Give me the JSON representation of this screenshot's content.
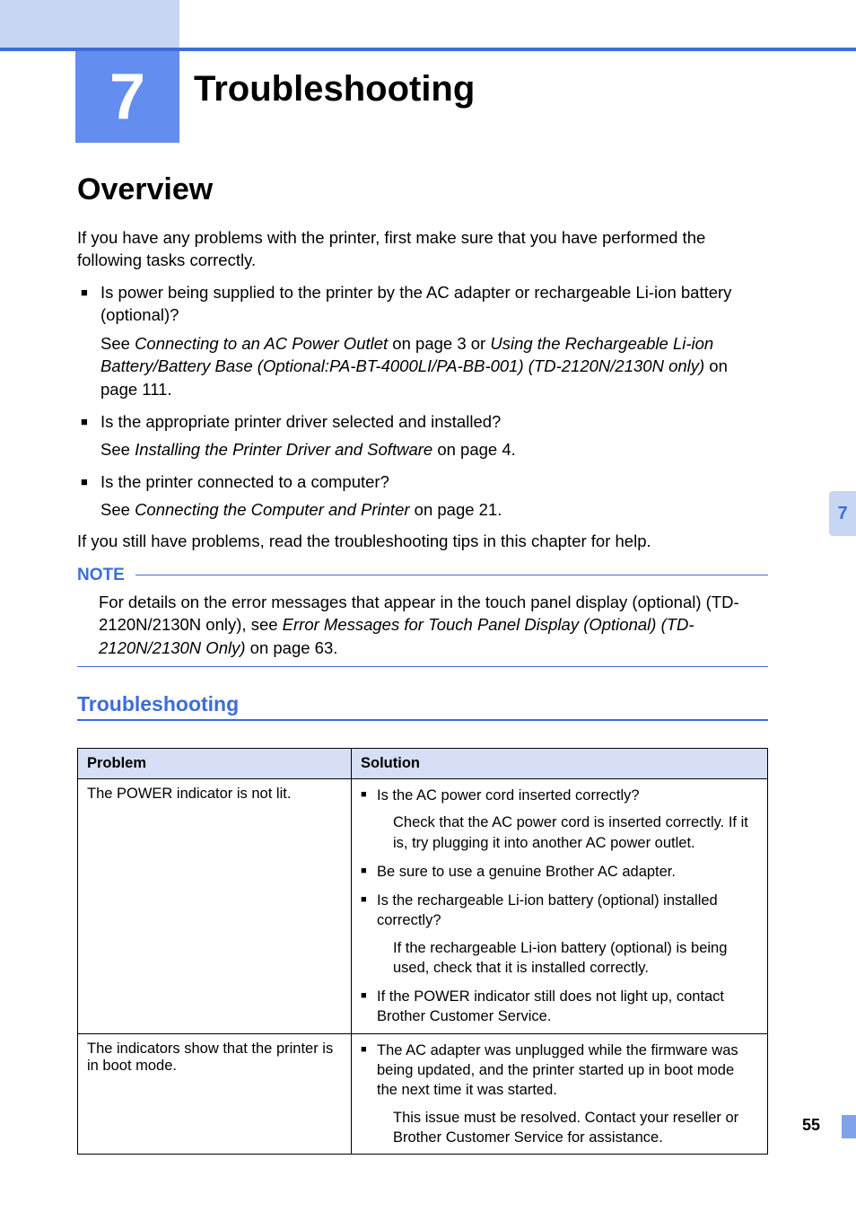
{
  "chapter": {
    "number": "7",
    "title": "Troubleshooting"
  },
  "tab": {
    "label": "7"
  },
  "overview": {
    "heading": "Overview",
    "intro": "If you have any problems with the printer, first make sure that you have performed the following tasks correctly.",
    "items": [
      {
        "q": "Is power being supplied to the printer by the AC adapter or rechargeable Li-ion battery (optional)?",
        "ref_pre": "See ",
        "ref_em1": "Connecting to an AC Power Outlet",
        "ref_mid": " on page 3 or ",
        "ref_em2": "Using the Rechargeable Li-ion Battery/Battery Base (Optional:PA-BT-4000LI/PA-BB-001) (TD-2120N/2130N only)",
        "ref_post": " on page 111."
      },
      {
        "q": "Is the appropriate printer driver selected and installed?",
        "ref_pre": "See ",
        "ref_em1": "Installing the Printer Driver and Software",
        "ref_post": " on page 4."
      },
      {
        "q": "Is the printer connected to a computer?",
        "ref_pre": "See ",
        "ref_em1": "Connecting the Computer and Printer",
        "ref_post": " on page 21."
      }
    ],
    "closing": "If you still have problems, read the troubleshooting tips in this chapter for help."
  },
  "note": {
    "label": "NOTE",
    "text_pre": "For details on the error messages that appear in the touch panel display (optional) (TD-2120N/2130N only), see ",
    "text_em": "Error Messages for Touch Panel Display (Optional) (TD-2120N/2130N Only)",
    "text_post": " on page 63."
  },
  "subheading": "Troubleshooting",
  "table": {
    "headers": {
      "problem": "Problem",
      "solution": "Solution"
    },
    "rows": [
      {
        "problem": "The POWER indicator is not lit.",
        "solutions": [
          {
            "bullet": "Is the AC power cord inserted correctly?",
            "sub": "Check that the AC power cord is inserted correctly. If it is, try plugging it into another AC power outlet."
          },
          {
            "bullet": "Be sure to use a genuine Brother AC adapter."
          },
          {
            "bullet": "Is the rechargeable Li-ion battery (optional) installed correctly?",
            "sub": "If the rechargeable Li-ion battery (optional) is being used, check that it is installed correctly."
          },
          {
            "bullet": "If the POWER indicator still does not light up, contact Brother Customer Service."
          }
        ]
      },
      {
        "problem": "The indicators show that the printer is in boot mode.",
        "solutions": [
          {
            "bullet": "The AC adapter was unplugged while the firmware was being updated, and the printer started up in boot mode the next time it was started.",
            "sub": "This issue must be resolved. Contact your reseller or Brother Customer Service for assistance."
          }
        ]
      }
    ]
  },
  "page_number": "55"
}
